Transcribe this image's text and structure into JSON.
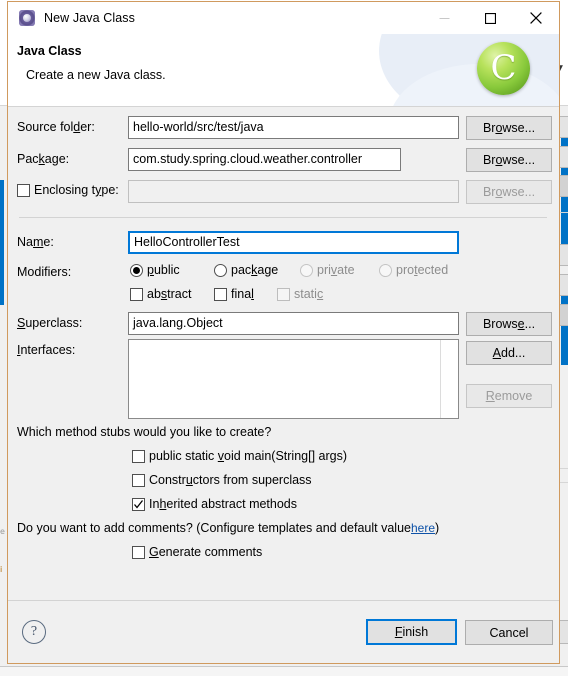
{
  "window": {
    "title": "New Java Class",
    "icon": "java-class-wizard-icon",
    "minimize_label": "—",
    "maximize_label": "□",
    "close_label": "✕"
  },
  "header": {
    "title": "Java Class",
    "description": "Create a new Java class.",
    "logo_letter": "C"
  },
  "form": {
    "source_folder": {
      "label": "Source folder:",
      "value": "hello-world/src/test/java",
      "button": "Browse..."
    },
    "package": {
      "label": "Package:",
      "value": "com.study.spring.cloud.weather.controller",
      "button": "Browse..."
    },
    "enclosing_type": {
      "label": "Enclosing type:",
      "checked": false,
      "value": "",
      "button": "Browse...",
      "disabled": true
    },
    "name": {
      "label": "Name:",
      "value": "HelloControllerTest",
      "focused": true
    },
    "modifiers": {
      "label": "Modifiers:",
      "radios": [
        {
          "label": "public",
          "checked": true,
          "disabled": false
        },
        {
          "label": "package",
          "checked": false,
          "disabled": false
        },
        {
          "label": "private",
          "checked": false,
          "disabled": true
        },
        {
          "label": "protected",
          "checked": false,
          "disabled": true
        }
      ],
      "checkboxes": [
        {
          "label": "abstract",
          "checked": false,
          "disabled": false
        },
        {
          "label": "final",
          "checked": false,
          "disabled": false
        },
        {
          "label": "static",
          "checked": false,
          "disabled": true
        }
      ]
    },
    "superclass": {
      "label": "Superclass:",
      "value": "java.lang.Object",
      "button": "Browse..."
    },
    "interfaces": {
      "label": "Interfaces:",
      "items": [],
      "add_button": "Add...",
      "remove_button": "Remove",
      "remove_disabled": true
    }
  },
  "stubs": {
    "question": "Which method stubs would you like to create?",
    "options": [
      {
        "label": "public static void main(String[] args)",
        "checked": false
      },
      {
        "label": "Constructors from superclass",
        "checked": false
      },
      {
        "label": "Inherited abstract methods",
        "checked": true
      }
    ]
  },
  "comments": {
    "question_prefix": "Do you want to add comments? (Configure templates and default value ",
    "link": "here",
    "question_suffix": ")",
    "option": {
      "label": "Generate comments",
      "checked": false
    }
  },
  "footer": {
    "help": "?",
    "finish": "Finish",
    "cancel": "Cancel"
  },
  "colors": {
    "accent": "#0078d7",
    "link": "#0e52a8",
    "dialog_border": "#d09a5e",
    "logo_green": "#88c93b",
    "backdrop_blue": "#0072c6"
  }
}
